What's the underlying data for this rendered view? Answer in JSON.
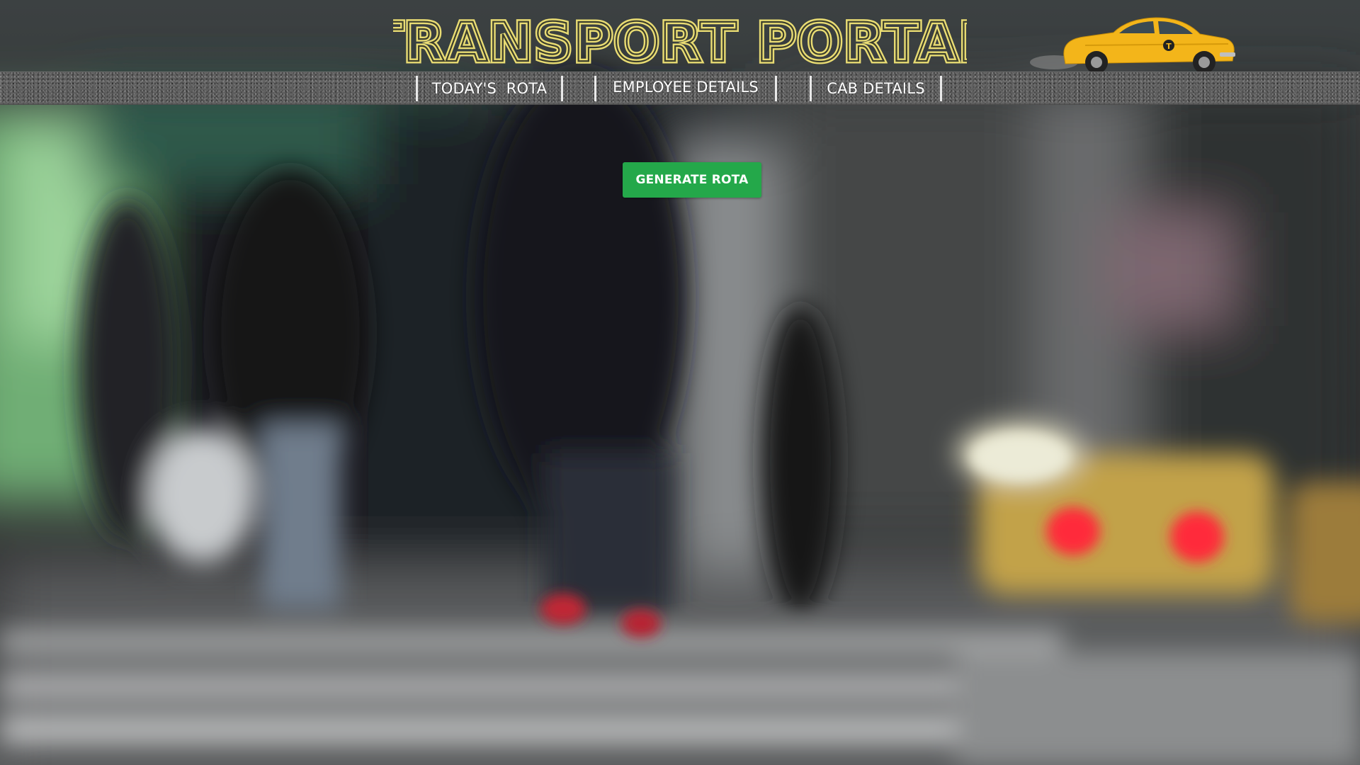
{
  "header": {
    "title": "TRANSPORT PORTAL",
    "title_color": "#e9dc73",
    "logo_icon": "taxi-icon",
    "logo_color": "#f3b51a"
  },
  "nav": {
    "items": [
      {
        "label": "TODAY'S  ROTA"
      },
      {
        "label": "EMPLOYEE DETAILS"
      },
      {
        "label": "CAB DETAILS"
      }
    ]
  },
  "main": {
    "generate_button_label": "GENERATE ROTA",
    "generate_button_color": "#24a84a"
  },
  "background": {
    "description_icon": "blurred-street-photo"
  }
}
